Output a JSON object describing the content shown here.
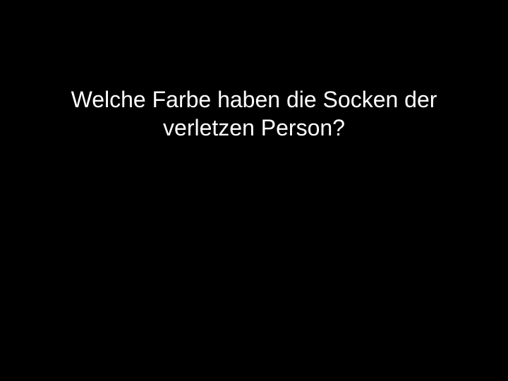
{
  "slide": {
    "question_lines": [
      "Welche Farbe haben die Socken der",
      "verletzen Person?"
    ],
    "background_color": "#000000",
    "text_color": "#ffffff"
  }
}
